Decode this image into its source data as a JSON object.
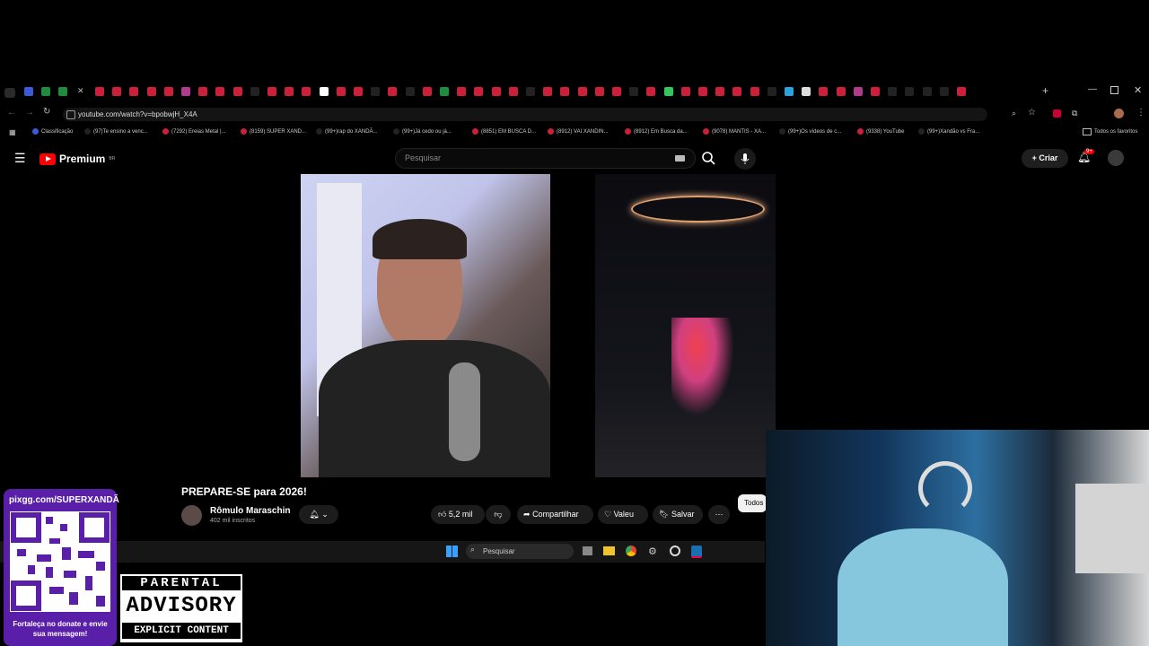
{
  "browser": {
    "url": "youtube.com/watch?v=bpobwjH_X4A",
    "bookmarks": [
      "Classificação",
      "(97)Te ensino a venc...",
      "(7292) Ereias Metal |...",
      "(8159) SUPER XAND...",
      "(99+)rap do XANDÃ...",
      "(99+)Já cedo ou já...",
      "(8851) EM BUSCA D...",
      "(8912) VAI XANDIN...",
      "(8912) Em Busca da...",
      "(9078) MANTIS - XA...",
      "(99+)Os vídeos de c...",
      "(9338) YouTube",
      "(99+)Xandão vs Fra..."
    ],
    "all_favorites": "Todos os favoritos"
  },
  "youtube": {
    "logo": "Premium",
    "region": "BR",
    "search_placeholder": "Pesquisar",
    "create_label": "Criar",
    "notifications": "9+"
  },
  "video": {
    "title": "PREPARE-SE para 2026!",
    "channel": "Rômulo Maraschin",
    "subscribers": "402 mil inscritos",
    "likes": "5,2 mil",
    "share": "Compartilhar",
    "thanks": "Valeu",
    "save": "Salvar",
    "filter_all": "Todos"
  },
  "taskbar": {
    "search": "Pesquisar"
  },
  "overlay": {
    "pix_url": "pixgg.com/SUPERXANDÃ",
    "donate_text": "Fortaleça no donate e envie sua mensagem!",
    "advisory_line1": "PARENTAL",
    "advisory_line2": "ADVISORY",
    "advisory_line3": "EXPLICIT CONTENT"
  },
  "colors": {
    "youtube_red": "#ff0000",
    "purple_panel": "#5a1fa8",
    "tab_red": "#cc1f3a"
  }
}
